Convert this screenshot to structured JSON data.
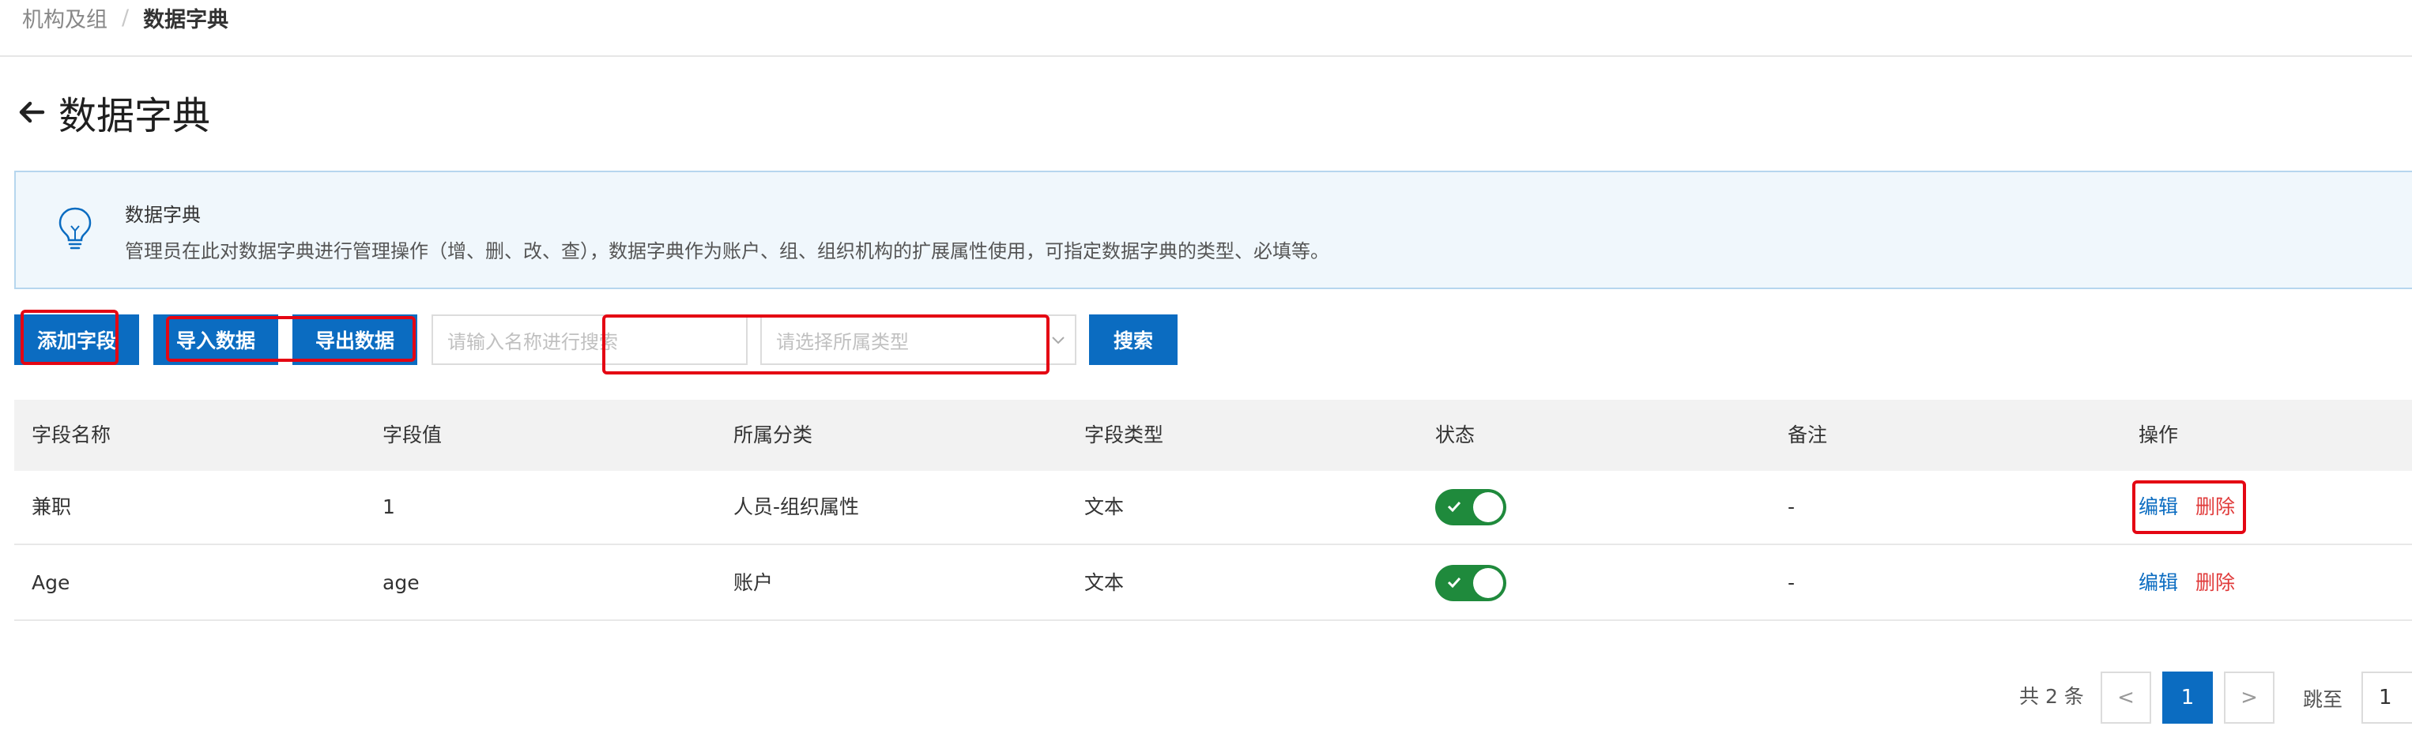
{
  "breadcrumb": {
    "parent": "机构及组",
    "separator": "/",
    "current": "数据字典"
  },
  "page": {
    "title": "数据字典"
  },
  "banner": {
    "title": "数据字典",
    "description": "管理员在此对数据字典进行管理操作（增、删、改、查），数据字典作为账户、组、组织机构的扩展属性使用，可指定数据字典的类型、必填等。"
  },
  "toolbar": {
    "add_label": "添加字段",
    "import_label": "导入数据",
    "export_label": "导出数据",
    "search_placeholder": "请输入名称进行搜索",
    "type_placeholder": "请选择所属类型",
    "search_label": "搜索"
  },
  "table": {
    "headers": [
      "字段名称",
      "字段值",
      "所属分类",
      "字段类型",
      "状态",
      "备注",
      "操作"
    ],
    "rows": [
      {
        "name": "兼职",
        "value": "1",
        "category": "人员-组织属性",
        "type": "文本",
        "status_on": true,
        "remark": "-",
        "edit": "编辑",
        "delete": "删除"
      },
      {
        "name": "Age",
        "value": "age",
        "category": "账户",
        "type": "文本",
        "status_on": true,
        "remark": "-",
        "edit": "编辑",
        "delete": "删除"
      }
    ]
  },
  "pagination": {
    "total": "共 2 条",
    "prev": "<",
    "current_page": "1",
    "next": ">",
    "jump_label": "跳至",
    "jump_value": "1"
  },
  "colors": {
    "primary": "#0b6cc1",
    "danger": "#e03a3a",
    "highlight": "#e40613",
    "switch_on": "#1f8a3c",
    "banner_bg": "#f0f7fc"
  }
}
